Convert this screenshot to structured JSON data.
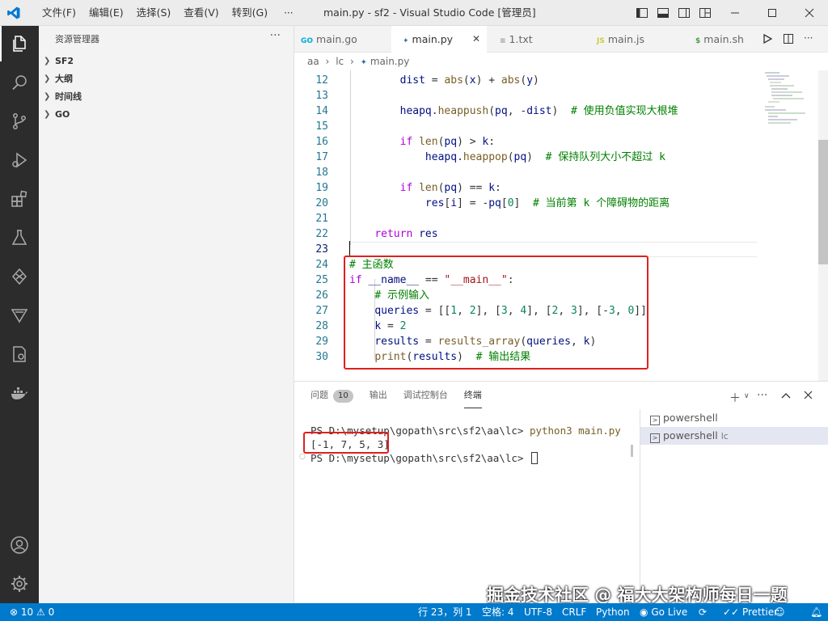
{
  "window": {
    "title": "main.py - sf2 - Visual Studio Code [管理员]"
  },
  "menu": {
    "items": [
      "文件(F)",
      "编辑(E)",
      "选择(S)",
      "查看(V)",
      "转到(G)"
    ],
    "more": "···"
  },
  "sidebar": {
    "title": "资源管理器",
    "more": "···",
    "sections": [
      "SF2",
      "大纲",
      "时间线",
      "GO"
    ]
  },
  "tabs": [
    {
      "label": "main.go",
      "icon_text": "GO",
      "icon_color": "#00add8",
      "active": false
    },
    {
      "label": "main.py",
      "icon_text": "py",
      "icon_color": "#3572a5",
      "active": true
    },
    {
      "label": "1.txt",
      "icon_text": "≡",
      "icon_color": "#999999",
      "active": false
    },
    {
      "label": "main.js",
      "icon_text": "JS",
      "icon_color": "#cbcb41",
      "active": false
    },
    {
      "label": "main.sh",
      "icon_text": "$",
      "icon_color": "#4d9a4d",
      "active": false
    }
  ],
  "breadcrumb": {
    "parts": [
      "aa",
      "lc",
      "main.py"
    ]
  },
  "code": {
    "line_numbers": [
      "12",
      "13",
      "14",
      "15",
      "16",
      "17",
      "18",
      "19",
      "20",
      "21",
      "22",
      "23",
      "24",
      "25",
      "26",
      "27",
      "28",
      "29",
      "30"
    ]
  },
  "panel": {
    "tabs": [
      {
        "label": "问题",
        "badge": "10"
      },
      {
        "label": "输出"
      },
      {
        "label": "调试控制台"
      },
      {
        "label": "终端",
        "active": true
      }
    ],
    "terminal": {
      "prompt1": "PS D:\\mysetup\\gopath\\src\\sf2\\aa\\lc> ",
      "cmd1": "python3 main.py",
      "output": "[-1, 7, 5, 3]",
      "prompt2": "PS D:\\mysetup\\gopath\\src\\sf2\\aa\\lc> "
    },
    "terminal_list": [
      {
        "label": "powershell",
        "suffix": ""
      },
      {
        "label": "powershell",
        "suffix": "lc",
        "active": true
      }
    ]
  },
  "status": {
    "errors": "10",
    "warnings": "0",
    "position": "行 23，列 1",
    "spaces": "空格: 4",
    "encoding": "UTF-8",
    "eol": "CRLF",
    "language": "Python",
    "golive": "Go Live",
    "prettier": "Prettier"
  },
  "watermark": "掘金技术社区 @ 福大大架构师每日一题",
  "colors": {
    "accent": "#007acc",
    "highlight": "#e02020",
    "activitybar": "#2c2c2c"
  }
}
